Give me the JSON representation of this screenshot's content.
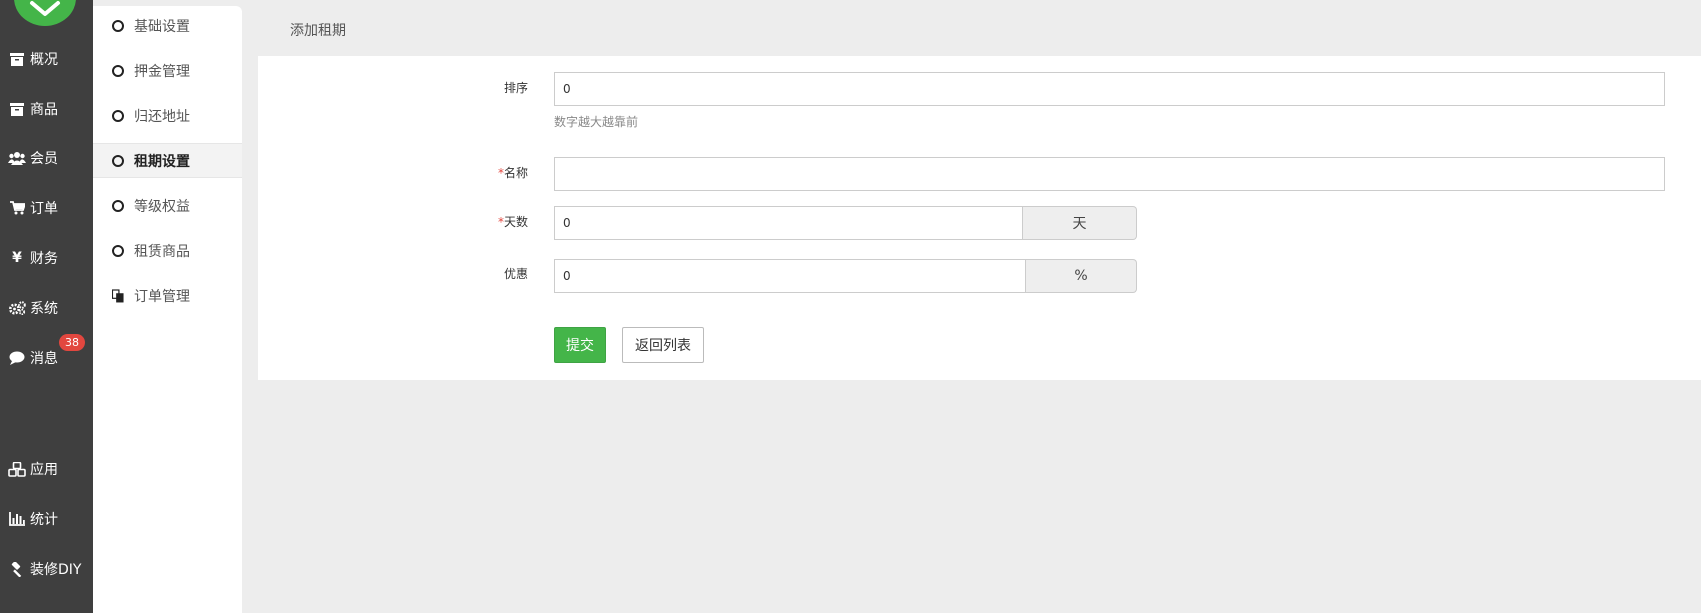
{
  "leftnav": {
    "items": [
      {
        "label": "概况",
        "icon": "archive-icon"
      },
      {
        "label": "商品",
        "icon": "archive-icon"
      },
      {
        "label": "会员",
        "icon": "users-icon"
      },
      {
        "label": "订单",
        "icon": "cart-icon"
      },
      {
        "label": "财务",
        "icon": "yen-icon"
      },
      {
        "label": "系统",
        "icon": "gears-icon"
      },
      {
        "label": "消息",
        "icon": "comment-icon"
      },
      {
        "label": "应用",
        "icon": "cubes-icon"
      },
      {
        "label": "统计",
        "icon": "bar-chart-icon"
      },
      {
        "label": "装修DIY",
        "icon": "gavel-icon"
      }
    ],
    "message_badge": "38"
  },
  "subnav": {
    "items": [
      {
        "label": "基础设置"
      },
      {
        "label": "押金管理"
      },
      {
        "label": "归还地址"
      },
      {
        "label": "租期设置",
        "active": true
      },
      {
        "label": "等级权益"
      },
      {
        "label": "租赁商品"
      },
      {
        "label": "订单管理"
      }
    ]
  },
  "page": {
    "title": "添加租期"
  },
  "form": {
    "sort": {
      "label": "排序",
      "value": "0",
      "help": "数字越大越靠前"
    },
    "name": {
      "required_mark": "*",
      "label": "名称",
      "value": ""
    },
    "days": {
      "required_mark": "*",
      "label": "天数",
      "value": "0",
      "addon": "天"
    },
    "discount": {
      "label": "优惠",
      "value": "0",
      "addon": "%"
    },
    "submit_label": "提交",
    "back_label": "返回列表"
  },
  "colors": {
    "accent": "#44b549",
    "sidebar": "#3f3f3f",
    "badge": "#e2473f"
  }
}
